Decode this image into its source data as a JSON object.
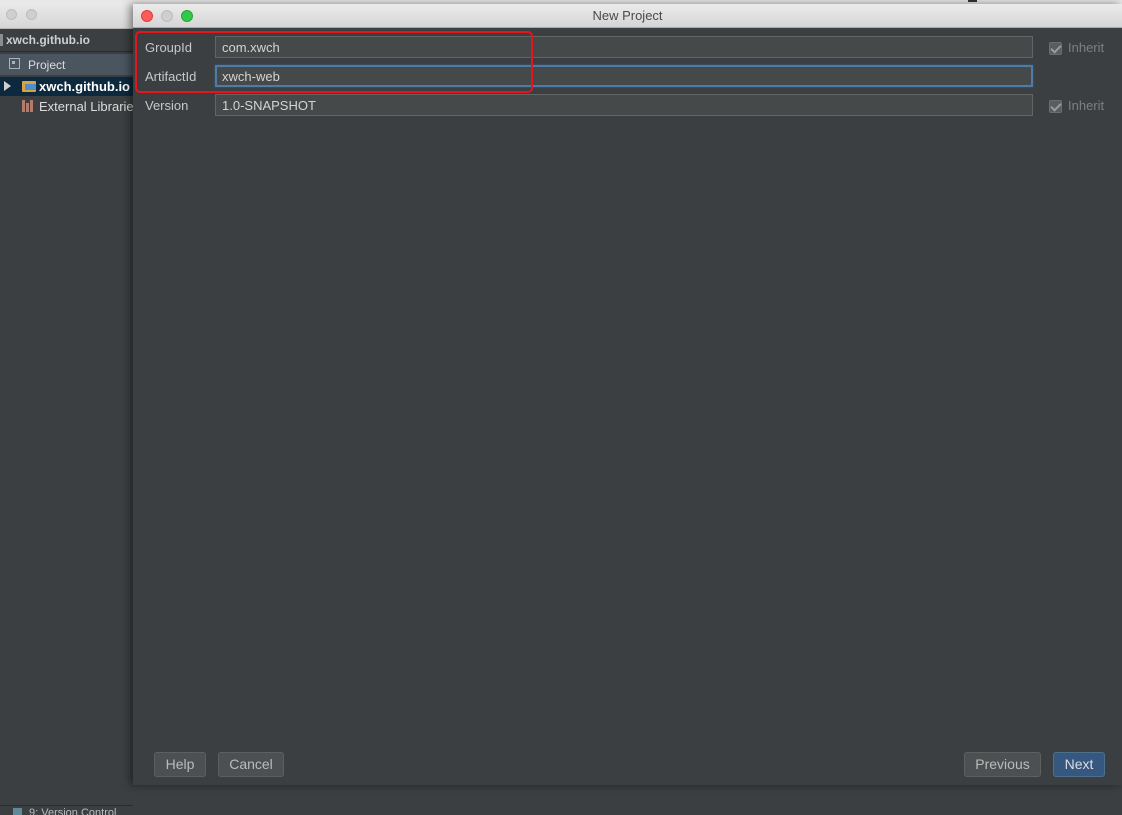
{
  "dialog": {
    "title": "New Project",
    "fields": {
      "group_id": {
        "label": "GroupId",
        "value": "com.xwch",
        "inherit_label": "Inherit",
        "inherit_checked": true
      },
      "artifact_id": {
        "label": "ArtifactId",
        "value": "xwch-web"
      },
      "version": {
        "label": "Version",
        "value": "1.0-SNAPSHOT",
        "inherit_label": "Inherit",
        "inherit_checked": true
      }
    },
    "buttons": {
      "help": "Help",
      "cancel": "Cancel",
      "previous": "Previous",
      "next": "Next"
    },
    "highlight_color": "#e8141b"
  },
  "sidebar": {
    "breadcrumb": "xwch.github.io",
    "project_tab": "Project",
    "tree": {
      "root": "xwch.github.io",
      "external": "External Librarie"
    },
    "bottom_tab": "9: Version Control"
  },
  "colors": {
    "background": "#3c3f41",
    "selection": "#0d293e",
    "focus_border": "#4e7ca6",
    "default_button": "#365880"
  }
}
